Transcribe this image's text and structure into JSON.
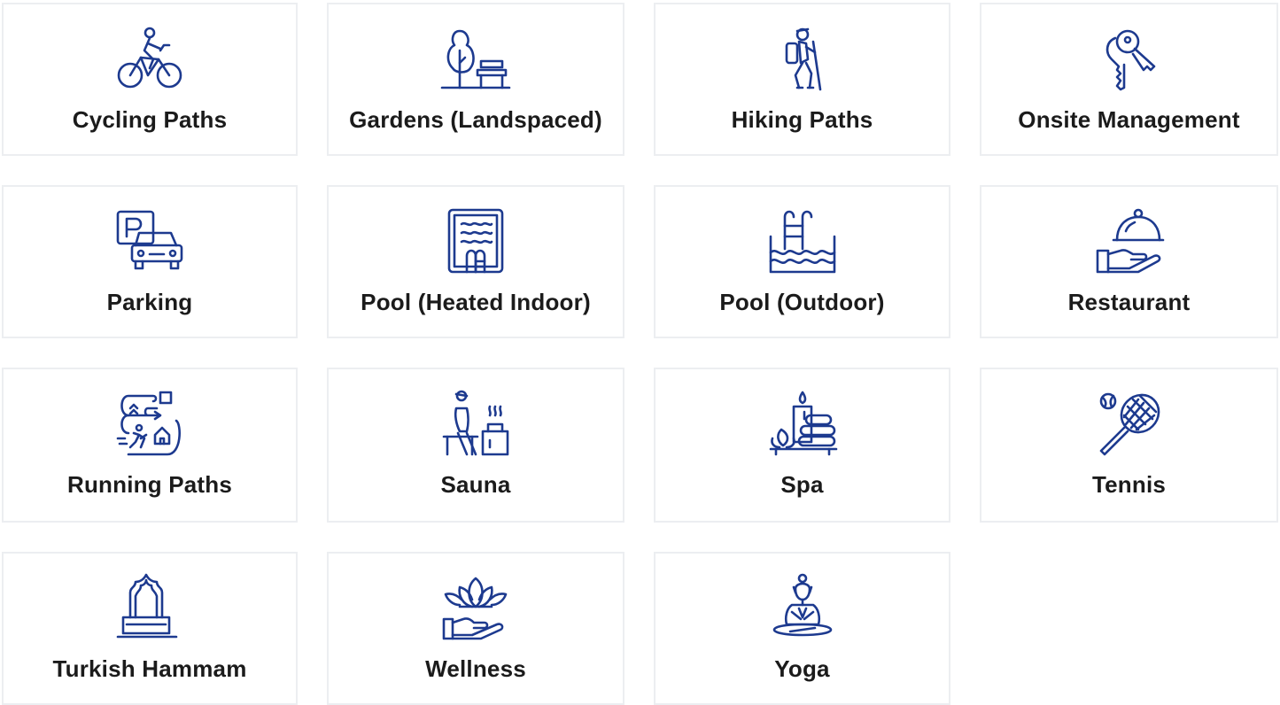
{
  "accent_color": "#1d3a8f",
  "amenities": [
    {
      "label": "Cycling Paths",
      "icon": "bicycle-icon"
    },
    {
      "label": "Gardens (Landspaced)",
      "icon": "garden-tree-bench-icon"
    },
    {
      "label": "Hiking Paths",
      "icon": "hiker-icon"
    },
    {
      "label": "Onsite Management",
      "icon": "keys-icon"
    },
    {
      "label": "Parking",
      "icon": "parking-car-icon"
    },
    {
      "label": "Pool (Heated Indoor)",
      "icon": "indoor-pool-icon"
    },
    {
      "label": "Pool (Outdoor)",
      "icon": "outdoor-pool-icon"
    },
    {
      "label": "Restaurant",
      "icon": "cloche-hand-icon"
    },
    {
      "label": "Running Paths",
      "icon": "running-route-icon"
    },
    {
      "label": "Sauna",
      "icon": "sauna-icon"
    },
    {
      "label": "Spa",
      "icon": "spa-stones-icon"
    },
    {
      "label": "Tennis",
      "icon": "tennis-racket-icon"
    },
    {
      "label": "Turkish Hammam",
      "icon": "hammam-icon"
    },
    {
      "label": "Wellness",
      "icon": "lotus-hand-icon"
    },
    {
      "label": "Yoga",
      "icon": "yoga-meditation-icon"
    }
  ]
}
